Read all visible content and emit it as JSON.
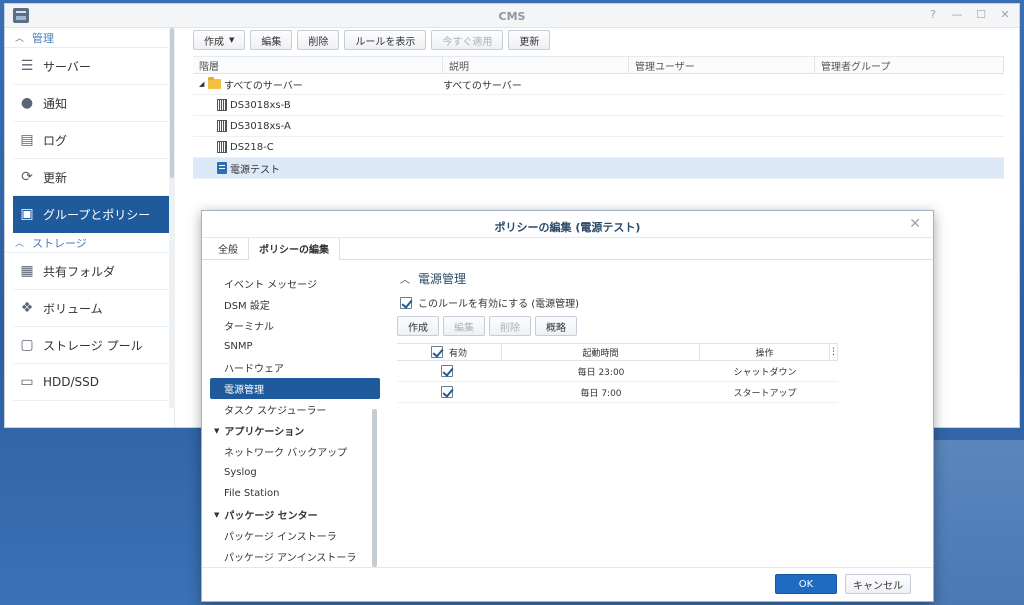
{
  "window": {
    "title": "CMS",
    "controls": [
      "?",
      "—",
      "☐",
      "✕"
    ]
  },
  "sidebar": {
    "section_manage": "管理",
    "items_manage": [
      {
        "label": "サーバー",
        "icon": "server-icon"
      },
      {
        "label": "通知",
        "icon": "chat-icon"
      },
      {
        "label": "ログ",
        "icon": "log-icon"
      },
      {
        "label": "更新",
        "icon": "refresh-icon"
      },
      {
        "label": "グループとポリシー",
        "icon": "policy-icon",
        "active": true
      }
    ],
    "section_storage": "ストレージ",
    "items_storage": [
      {
        "label": "共有フォルダ",
        "icon": "shared-folder-icon"
      },
      {
        "label": "ボリューム",
        "icon": "volume-icon"
      },
      {
        "label": "ストレージ プール",
        "icon": "storage-pool-icon"
      },
      {
        "label": "HDD/SSD",
        "icon": "disk-icon"
      }
    ]
  },
  "toolbar": {
    "create": "作成",
    "edit": "編集",
    "delete": "削除",
    "show_rules": "ルールを表示",
    "apply_now": "今すぐ適用",
    "refresh": "更新"
  },
  "grid": {
    "columns": [
      "階層",
      "説明",
      "管理ユーザー",
      "管理者グループ"
    ],
    "rows": [
      {
        "name": "すべてのサーバー",
        "desc": "すべてのサーバー",
        "type": "folder"
      },
      {
        "name": "DS3018xs-B",
        "desc": "",
        "type": "server"
      },
      {
        "name": "DS3018xs-A",
        "desc": "",
        "type": "server"
      },
      {
        "name": "DS218-C",
        "desc": "",
        "type": "server"
      },
      {
        "name": "電源テスト",
        "desc": "",
        "type": "policy",
        "selected": true
      }
    ]
  },
  "dialog": {
    "title": "ポリシーの編集 (電源テスト)",
    "close": "✕",
    "tabs": [
      "全般",
      "ポリシーの編集"
    ],
    "nav": {
      "items_top": [
        "イベント メッセージ",
        "DSM 設定",
        "ターミナル",
        "SNMP",
        "ハードウェア",
        "電源管理",
        "タスク スケジューラー"
      ],
      "group_app": "アプリケーション",
      "items_app": [
        "ネットワーク バックアップ",
        "Syslog",
        "File Station"
      ],
      "group_pkg": "パッケージ センター",
      "items_pkg": [
        "パッケージ インストーラ",
        "パッケージ アンインストーラ"
      ]
    },
    "section_title": "電源管理",
    "enable_label": "このルールを有効にする (電源管理)",
    "buttons": {
      "create": "作成",
      "edit": "編集",
      "delete": "削除",
      "summary": "概略"
    },
    "table": {
      "columns": [
        "有効",
        "起動時間",
        "操作"
      ],
      "rows": [
        {
          "enabled": true,
          "time": "毎日 23:00",
          "action": "シャットダウン"
        },
        {
          "enabled": true,
          "time": "毎日 7:00",
          "action": "スタートアップ"
        }
      ]
    },
    "ok": "OK",
    "cancel": "キャンセル"
  }
}
